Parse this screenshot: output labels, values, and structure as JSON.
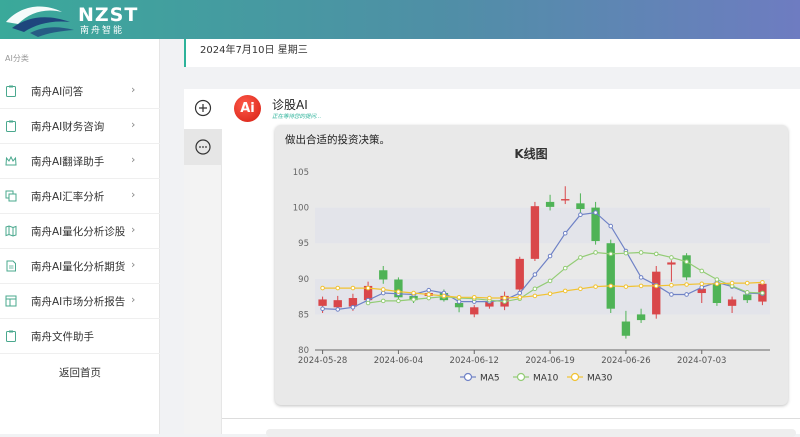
{
  "brand": {
    "name": "NZST",
    "subtitle": "南舟智能"
  },
  "sidebar": {
    "category_label": "AI分类",
    "items": [
      {
        "label": "南舟AI问答",
        "icon": "clipboard-icon"
      },
      {
        "label": "南舟AI财务咨询",
        "icon": "clipboard-icon"
      },
      {
        "label": "南舟AI翻译助手",
        "icon": "crown-icon"
      },
      {
        "label": "南舟AI汇率分析",
        "icon": "copy-icon"
      },
      {
        "label": "南舟AI量化分析诊股",
        "icon": "map-icon"
      },
      {
        "label": "南舟AI量化分析期货",
        "icon": "document-icon"
      },
      {
        "label": "南舟AI市场分析报告",
        "icon": "layout-icon"
      },
      {
        "label": "南舟文件助手",
        "icon": "clipboard-icon"
      }
    ],
    "back_label": "返回首页"
  },
  "header": {
    "date": "2024年7月10日 星期三"
  },
  "chat": {
    "ai_avatar_text": "Ai",
    "ai_name": "诊股AI",
    "ai_status": "正在等待您的提问...",
    "message_text": "做出合适的投资决策。"
  },
  "colors": {
    "accent": "#2db39a",
    "up": "#d9474a",
    "down": "#4fb356",
    "ma5": "#6f82c6",
    "ma10": "#93cc75",
    "ma30": "#f1c232"
  },
  "chart_data": {
    "type": "candlestick",
    "title": "K线图",
    "ylim": [
      80,
      105
    ],
    "yticks": [
      80,
      85,
      90,
      95,
      100,
      105
    ],
    "xtick_labels": [
      "2024-05-28",
      "2024-06-04",
      "2024-06-12",
      "2024-06-19",
      "2024-06-26",
      "2024-07-03"
    ],
    "xtick_indices": [
      0,
      5,
      10,
      15,
      20,
      25
    ],
    "legend": [
      "MA5",
      "MA10",
      "MA30"
    ],
    "legend_position": "bottom",
    "grid": "horizontal-bands",
    "candles": [
      {
        "open": 86.2,
        "close": 87.1,
        "high": 87.5,
        "low": 85.2
      },
      {
        "open": 86.0,
        "close": 87.0,
        "high": 87.6,
        "low": 85.6
      },
      {
        "open": 86.1,
        "close": 87.3,
        "high": 87.9,
        "low": 85.5
      },
      {
        "open": 87.0,
        "close": 89.0,
        "high": 89.6,
        "low": 86.4
      },
      {
        "open": 91.2,
        "close": 89.9,
        "high": 91.8,
        "low": 89.3
      },
      {
        "open": 89.9,
        "close": 87.4,
        "high": 90.2,
        "low": 86.9
      },
      {
        "open": 87.6,
        "close": 87.0,
        "high": 88.2,
        "low": 86.6
      },
      {
        "open": 87.6,
        "close": 88.0,
        "high": 88.3,
        "low": 87.0
      },
      {
        "open": 88.0,
        "close": 87.0,
        "high": 88.5,
        "low": 86.8
      },
      {
        "open": 86.6,
        "close": 86.0,
        "high": 87.2,
        "low": 85.3
      },
      {
        "open": 85.0,
        "close": 86.0,
        "high": 86.3,
        "low": 84.6
      },
      {
        "open": 86.1,
        "close": 86.8,
        "high": 87.3,
        "low": 85.8
      },
      {
        "open": 86.1,
        "close": 87.6,
        "high": 88.2,
        "low": 85.6
      },
      {
        "open": 88.5,
        "close": 92.8,
        "high": 93.1,
        "low": 88.1
      },
      {
        "open": 92.8,
        "close": 100.2,
        "high": 100.8,
        "low": 92.5
      },
      {
        "open": 100.8,
        "close": 100.1,
        "high": 101.8,
        "low": 99.6
      },
      {
        "open": 101.0,
        "close": 101.2,
        "high": 103.0,
        "low": 100.5
      },
      {
        "open": 100.6,
        "close": 99.8,
        "high": 102.0,
        "low": 99.2
      },
      {
        "open": 100.0,
        "close": 95.3,
        "high": 100.8,
        "low": 94.8
      },
      {
        "open": 95.0,
        "close": 85.8,
        "high": 95.5,
        "low": 85.2
      },
      {
        "open": 84.0,
        "close": 82.0,
        "high": 85.5,
        "low": 81.6
      },
      {
        "open": 85.0,
        "close": 84.2,
        "high": 85.8,
        "low": 83.8
      },
      {
        "open": 85.0,
        "close": 91.0,
        "high": 91.8,
        "low": 84.4
      },
      {
        "open": 92.0,
        "close": 92.3,
        "high": 92.6,
        "low": 89.6
      },
      {
        "open": 93.3,
        "close": 90.2,
        "high": 93.6,
        "low": 89.8
      },
      {
        "open": 88.0,
        "close": 88.6,
        "high": 89.2,
        "low": 86.6
      },
      {
        "open": 89.3,
        "close": 86.6,
        "high": 89.8,
        "low": 86.2
      },
      {
        "open": 86.2,
        "close": 87.1,
        "high": 87.5,
        "low": 85.2
      },
      {
        "open": 87.8,
        "close": 87.0,
        "high": 88.0,
        "low": 86.6
      },
      {
        "open": 86.8,
        "close": 89.3,
        "high": 89.6,
        "low": 86.3
      }
    ],
    "series": [
      {
        "name": "MA5",
        "values": [
          85.8,
          85.7,
          86.0,
          87.0,
          88.0,
          87.9,
          87.8,
          88.4,
          88.0,
          86.8,
          86.8,
          86.8,
          87.0,
          88.0,
          90.6,
          93.2,
          96.4,
          99.0,
          99.3,
          97.4,
          93.9,
          90.2,
          89.1,
          87.8,
          87.8,
          88.8,
          89.5,
          88.9,
          88.0,
          87.9
        ]
      },
      {
        "name": "MA10",
        "values": [
          null,
          null,
          null,
          86.6,
          86.9,
          86.9,
          87.1,
          87.3,
          87.5,
          87.3,
          87.2,
          87.0,
          86.8,
          87.2,
          88.6,
          89.7,
          91.5,
          93.0,
          93.7,
          93.5,
          93.6,
          93.7,
          93.5,
          93.0,
          92.4,
          91.1,
          89.9,
          89.0,
          88.1,
          88.0
        ]
      },
      {
        "name": "MA30",
        "values": [
          88.7,
          88.7,
          88.7,
          88.7,
          88.5,
          88.2,
          88.0,
          87.8,
          87.6,
          87.4,
          87.4,
          87.3,
          87.3,
          87.4,
          87.6,
          87.9,
          88.3,
          88.6,
          88.9,
          89.0,
          88.9,
          89.0,
          89.0,
          89.1,
          89.2,
          89.3,
          89.3,
          89.4,
          89.4,
          89.5
        ]
      }
    ]
  }
}
